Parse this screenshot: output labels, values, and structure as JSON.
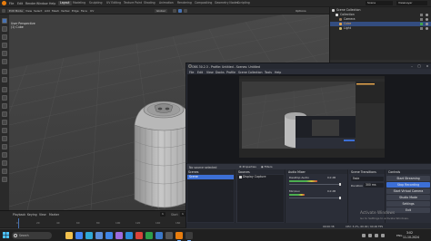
{
  "blender": {
    "menu": [
      "File",
      "Edit",
      "Render",
      "Window",
      "Help"
    ],
    "workspaces": [
      "Layout",
      "Modeling",
      "Sculpting",
      "UV Editing",
      "Texture Paint",
      "Shading",
      "Animation",
      "Rendering",
      "Compositing",
      "Geometry Nodes",
      "Scripting"
    ],
    "active_workspace": "Layout",
    "scene": "Scene",
    "view_layer": "ViewLayer",
    "header": {
      "mode": "Edit Mode",
      "view": "View",
      "select": "Select",
      "add": "Add",
      "mesh": "Mesh",
      "vertex": "Vertex",
      "edge": "Edge",
      "face": "Face",
      "uv": "UV",
      "transform": "Global",
      "options": "Options"
    },
    "viewport": {
      "label1": "User Perspective",
      "label2": "(1) Cube"
    },
    "outliner": {
      "rows": [
        {
          "label": "Scene Collection",
          "color": "#d0d0d0"
        },
        {
          "label": "Collection",
          "color": "#d0d0d0"
        },
        {
          "label": "Camera",
          "color": "#d0d0d0"
        },
        {
          "label": "Cube",
          "color": "#e6a54c"
        },
        {
          "label": "Light",
          "color": "#d0d0d0"
        }
      ]
    },
    "timeline": {
      "playback": "Playback",
      "keying": "Keying",
      "view": "View",
      "marker": "Marker",
      "frame": "1",
      "start_label": "Start",
      "start": "1",
      "end_label": "End",
      "end": "250",
      "ticks": [
        "0",
        "20",
        "40",
        "60",
        "80",
        "100",
        "120",
        "140",
        "160",
        "180",
        "200",
        "220",
        "240"
      ]
    }
  },
  "obs": {
    "title": "OBS 30.2.3 - Profile: Untitled - Scenes: Untitled",
    "menu": [
      "File",
      "Edit",
      "View",
      "Docks",
      "Profile",
      "Scene Collection",
      "Tools",
      "Help"
    ],
    "no_source": "No source selected",
    "properties": "Properties",
    "filters": "Filters",
    "docks": {
      "scenes": {
        "title": "Scenes",
        "item": "Scene"
      },
      "sources": {
        "title": "Sources",
        "item": "Display Capture"
      },
      "mixer": {
        "title": "Audio Mixer",
        "channels": [
          {
            "name": "Desktop Audio",
            "db": "0.0 dB",
            "level": 0.55
          },
          {
            "name": "Mic/Aux",
            "db": "0.0 dB",
            "level": 0.3
          }
        ]
      },
      "transitions": {
        "title": "Scene Transitions",
        "type": "Fade",
        "duration_label": "Duration",
        "duration": "300 ms"
      },
      "controls": {
        "title": "Controls",
        "buttons": [
          "Start Streaming",
          "Stop Recording",
          "Start Virtual Camera",
          "Studio Mode",
          "Settings",
          "Exit"
        ]
      }
    },
    "status": {
      "rec": "00:00:38",
      "cpu": "CPU: 3.2%, 60.00 / 60.00 FPS"
    },
    "watermark": {
      "line1": "Activate Windows",
      "line2": "Go to Settings to activate Windows."
    }
  },
  "taskbar": {
    "search_placeholder": "Search",
    "lang": "ENG",
    "time": "3:02",
    "date": "11-10-2024",
    "apps": [
      {
        "name": "file-explorer",
        "color": "#f2c14e"
      },
      {
        "name": "chrome",
        "color": "#4285f4"
      },
      {
        "name": "edge",
        "color": "#2fa8d6"
      },
      {
        "name": "store",
        "color": "#5b8dd9"
      },
      {
        "name": "mail",
        "color": "#3f84e5"
      },
      {
        "name": "photos",
        "color": "#9c6ade"
      },
      {
        "name": "vscode",
        "color": "#2a8ad6"
      },
      {
        "name": "app-red",
        "color": "#d9433a"
      },
      {
        "name": "app-green",
        "color": "#2d9e4a"
      },
      {
        "name": "app-blue",
        "color": "#3a78c9"
      },
      {
        "name": "app-dark",
        "color": "#555555"
      },
      {
        "name": "blender",
        "color": "#e87d0d"
      },
      {
        "name": "obs",
        "color": "#3c3c3c"
      }
    ]
  }
}
